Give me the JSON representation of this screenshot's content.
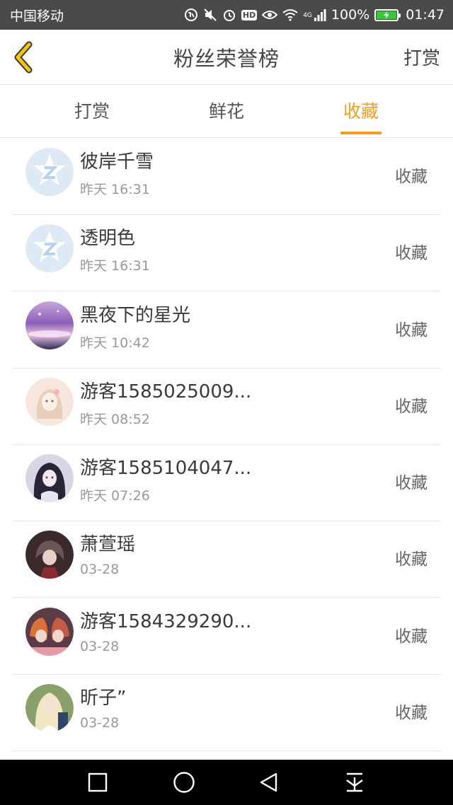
{
  "status_bar": {
    "carrier": "中国移动",
    "network": "4G",
    "battery": "100%",
    "time": "01:47",
    "icons": [
      "hd-voice-icon",
      "mute-icon",
      "alarm-icon",
      "hd-icon",
      "eye-icon",
      "wifi-icon",
      "signal-icon",
      "battery-charging-icon"
    ]
  },
  "header": {
    "title": "粉丝荣誉榜",
    "back_icon": "chevron-left-icon",
    "action_label": "打赏"
  },
  "tabs": [
    {
      "label": "打赏",
      "active": false
    },
    {
      "label": "鲜花",
      "active": false
    },
    {
      "label": "收藏",
      "active": true
    }
  ],
  "colors": {
    "accent": "#f0a01e",
    "status_bar": "#4a4a4a",
    "nav_bar": "#000000"
  },
  "fans": [
    {
      "name": "彼岸千雪",
      "time": "昨天 16:31",
      "action": "收藏",
      "avatar": "default-avatar-icon"
    },
    {
      "name": "透明色",
      "time": "昨天 16:31",
      "action": "收藏",
      "avatar": "default-avatar-icon"
    },
    {
      "name": "黑夜下的星光",
      "time": "昨天 10:42",
      "action": "收藏",
      "avatar": "user-avatar"
    },
    {
      "name": "游客1585025009...",
      "time": "昨天 08:52",
      "action": "收藏",
      "avatar": "user-avatar"
    },
    {
      "name": "游客1585104047...",
      "time": "昨天 07:26",
      "action": "收藏",
      "avatar": "user-avatar"
    },
    {
      "name": "萧萱瑶",
      "time": "03-28",
      "action": "收藏",
      "avatar": "user-avatar"
    },
    {
      "name": "游客1584329290...",
      "time": "03-28",
      "action": "收藏",
      "avatar": "user-avatar"
    },
    {
      "name": "昕子”",
      "time": "03-28",
      "action": "收藏",
      "avatar": "user-avatar"
    }
  ],
  "nav_bar": {
    "buttons": [
      "recents-square-icon",
      "home-circle-icon",
      "back-triangle-icon",
      "notification-pull-icon"
    ]
  }
}
